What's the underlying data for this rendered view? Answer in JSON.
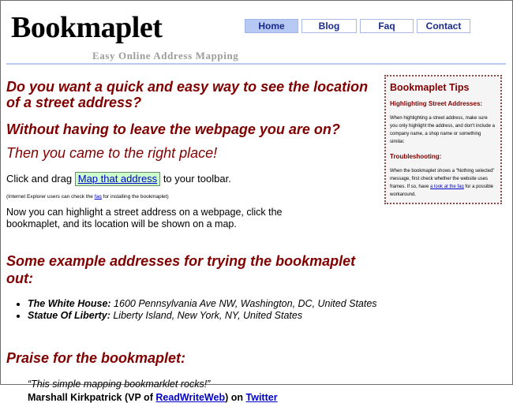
{
  "site": {
    "logo": "Bookmaplet",
    "tagline": "Easy Online Address Mapping"
  },
  "nav": {
    "items": [
      {
        "label": "Home"
      },
      {
        "label": "Blog"
      },
      {
        "label": "Faq"
      },
      {
        "label": "Contact"
      }
    ],
    "active": "Home"
  },
  "main": {
    "question1": "Do you want a quick and easy way to see the location of a street address?",
    "question2": "Without having to leave the webpage you are on?",
    "answer": "Then you came to the right place!",
    "drag_prefix": "Click and drag",
    "bookmarklet_label": "Map that address",
    "drag_suffix": "to your toolbar.",
    "ie_note_prefix": "(Internet Explorer users can check the",
    "ie_note_link": "faq",
    "ie_note_suffix": "for installing the bookmaplet)",
    "howto": "Now you can highlight a street address on a webpage, click the bookmaplet, and its location will be shown on a map.",
    "examples_title": "Some example addresses for trying the bookmaplet out:",
    "examples": [
      {
        "name": "The White House:",
        "address": "1600 Pennsylvania Ave NW, Washington, DC, United States"
      },
      {
        "name": "Statue Of Liberty:",
        "address": "Liberty Island, New York, NY, United States"
      }
    ],
    "praise_title": "Praise for the bookmaplet:",
    "quote": "“This simple mapping bookmarklet rocks!”",
    "author_name": "Marshall Kirkpatrick (VP of",
    "author_link1": "ReadWriteWeb",
    "author_mid": ") on",
    "author_link2": "Twitter"
  },
  "tips": {
    "title": "Bookmaplet Tips",
    "h1": "Highlighting Street Addresses:",
    "p1": "When highlighting a street address, make sure you only highlight the address, and don't include a company name, a shop name or something similar.",
    "h2": "Troubleshooting:",
    "p2_prefix": "When the bookmaplet shows a “Nothing selected” message, first check whether the website uses frames. If so, have",
    "p2_link": "a look at the faq",
    "p2_suffix": "for a possible workaround."
  },
  "colors": {
    "accent": "#800000",
    "nav_active_bg": "#b7c8f2",
    "link": "#0000cc",
    "bookmarklet_bg": "#ccffcc"
  }
}
